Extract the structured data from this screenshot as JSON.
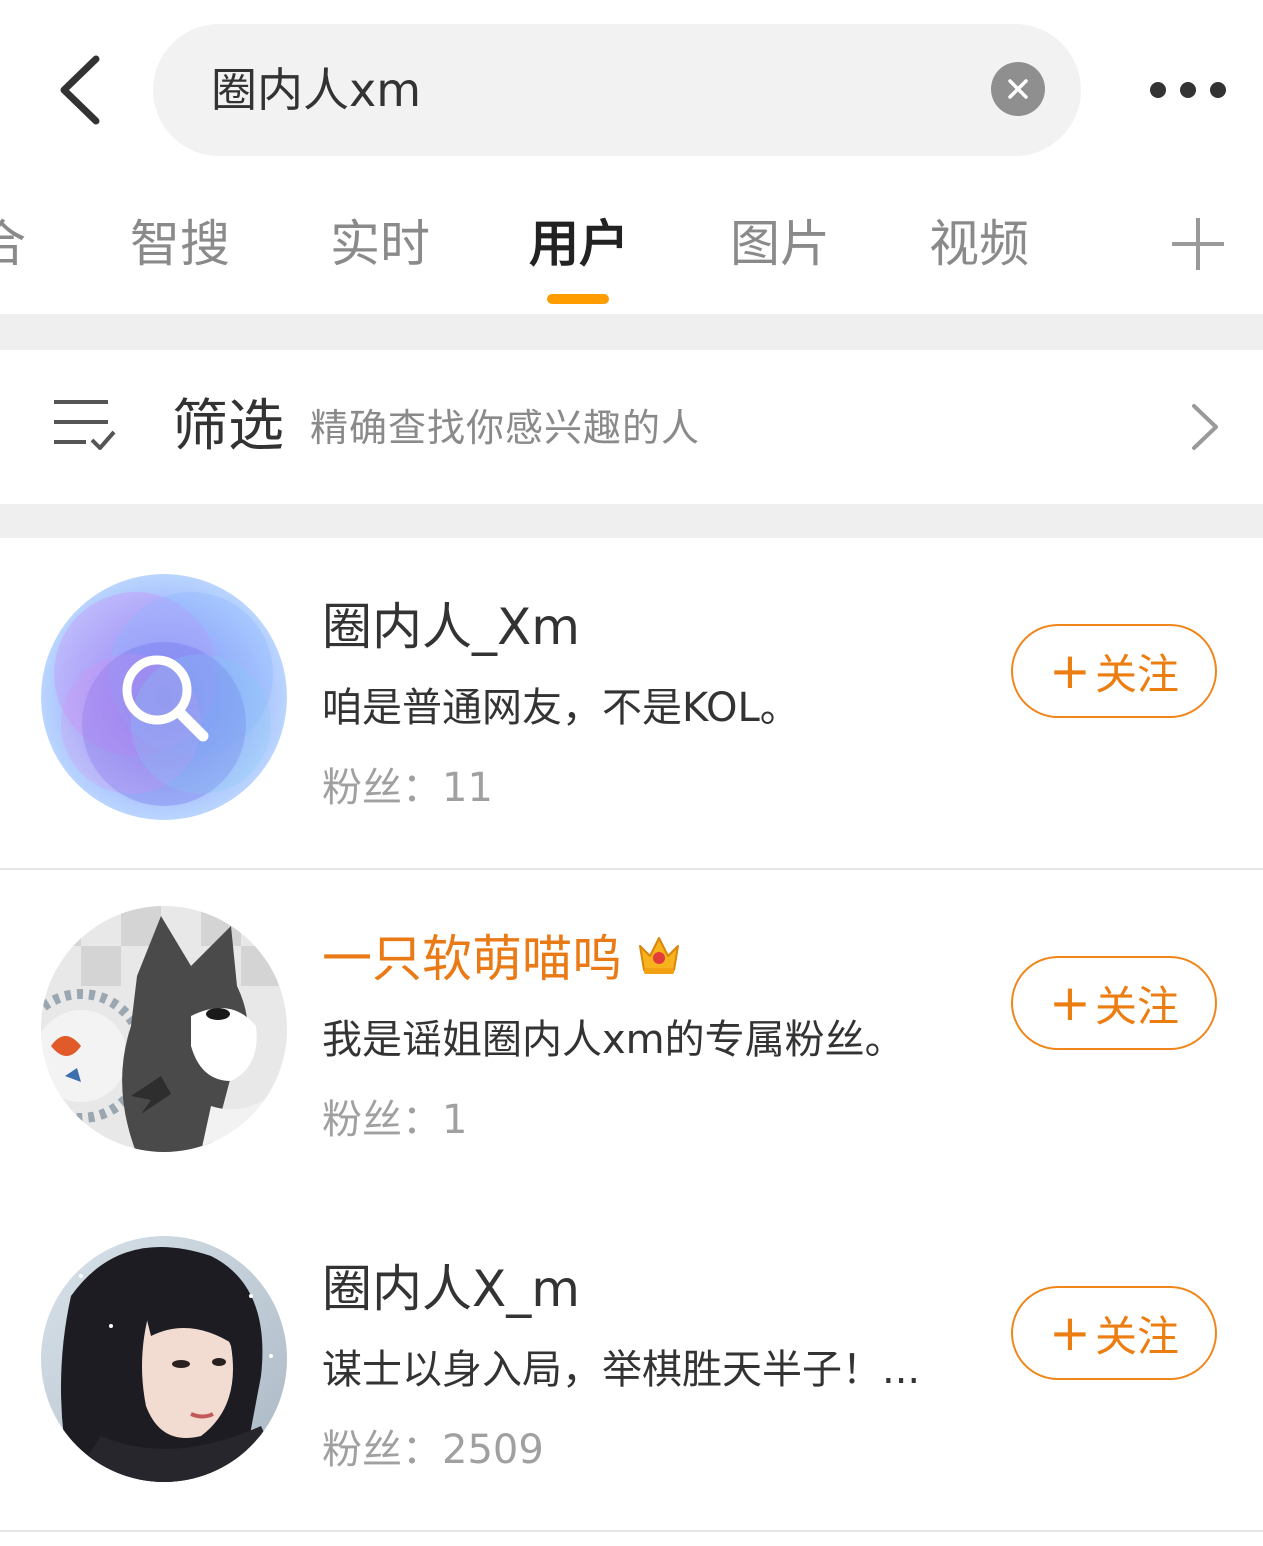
{
  "search": {
    "query": "圈内人xm"
  },
  "icons": {
    "back": "chevron-left-icon",
    "clear": "close-circle-icon",
    "more": "more-horizontal-icon",
    "add_tab": "plus-icon",
    "filter": "filter-list-icon",
    "chevron": "chevron-right-icon",
    "vip": "crown-icon"
  },
  "tabs": [
    {
      "label": "合",
      "active": false
    },
    {
      "label": "智搜",
      "active": false
    },
    {
      "label": "实时",
      "active": false
    },
    {
      "label": "用户",
      "active": true
    },
    {
      "label": "图片",
      "active": false
    },
    {
      "label": "视频",
      "active": false
    }
  ],
  "filter": {
    "title": "筛选",
    "description": "精确查找你感兴趣的人"
  },
  "users": [
    {
      "name": "圈内人_Xm",
      "bio": "咱是普通网友，不是KOL。",
      "fans_label": "粉丝：",
      "fans": "11",
      "vip": false,
      "follow_label": "关注"
    },
    {
      "name": "一只软萌喵呜",
      "bio": "我是谣姐圈内人xm的专属粉丝。",
      "fans_label": "粉丝：",
      "fans": "1",
      "vip": true,
      "follow_label": "关注"
    },
    {
      "name": "圈内人X_m",
      "bio": "谋士以身入局，举棋胜天半子！...",
      "fans_label": "粉丝：",
      "fans": "2509",
      "vip": false,
      "follow_label": "关注"
    }
  ],
  "colors": {
    "accent": "#ff9c00",
    "follow": "#ec7d10",
    "vip_name": "#ea7a16",
    "divider": "#efefef"
  }
}
